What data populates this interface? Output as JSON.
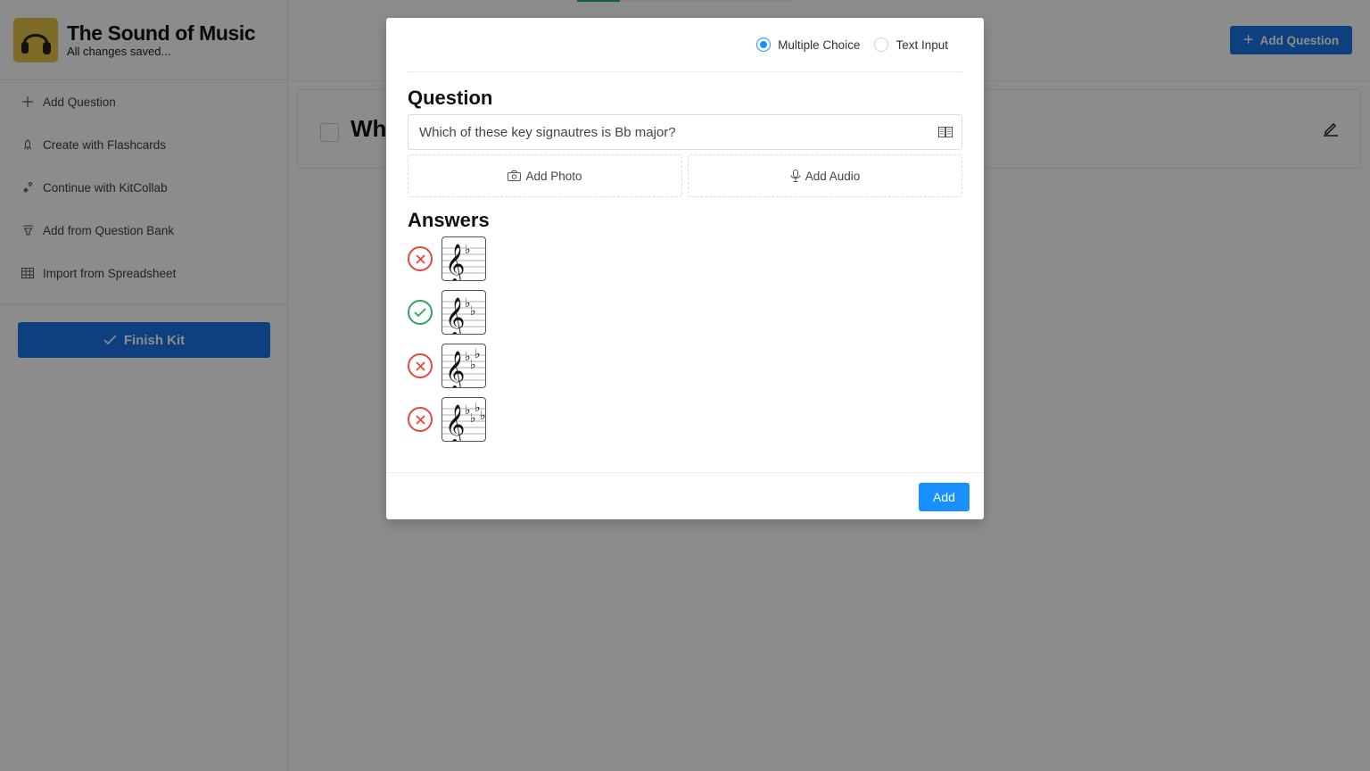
{
  "app": {
    "kit_title": "The Sound of Music",
    "save_status": "All changes saved...",
    "logo_icon": "headphones-icon"
  },
  "progress": {
    "percent": 20,
    "color": "#2fb067"
  },
  "sidebar": {
    "items": [
      {
        "label": "Add Question",
        "icon": "plus-icon"
      },
      {
        "label": "Create with Flashcards",
        "icon": "rocket-icon"
      },
      {
        "label": "Continue with KitCollab",
        "icon": "link-icon"
      },
      {
        "label": "Add from Question Bank",
        "icon": "filter-icon"
      },
      {
        "label": "Import from Spreadsheet",
        "icon": "table-icon"
      }
    ],
    "finish_label": "Finish Kit"
  },
  "header": {
    "add_question_label": "Add Question"
  },
  "question_card": {
    "title_visible": "Wh"
  },
  "modal": {
    "type_options": [
      {
        "label": "Multiple Choice",
        "selected": true
      },
      {
        "label": "Text Input",
        "selected": false
      }
    ],
    "question_heading": "Question",
    "question_text": "Which of these key signautres is Bb major?",
    "add_photo_label": "Add Photo",
    "add_audio_label": "Add Audio",
    "answers_heading": "Answers",
    "answers": [
      {
        "flats": 1,
        "correct": false,
        "image": "treble-clef-1-flat"
      },
      {
        "flats": 2,
        "correct": true,
        "image": "treble-clef-2-flats"
      },
      {
        "flats": 3,
        "correct": false,
        "image": "treble-clef-3-flats"
      },
      {
        "flats": 4,
        "correct": false,
        "image": "treble-clef-4-flats"
      }
    ],
    "submit_label": "Add"
  },
  "colors": {
    "primary": "#1a74e8",
    "modal_primary": "#1890ff",
    "correct": "#2fa35f",
    "wrong": "#e6483d"
  }
}
